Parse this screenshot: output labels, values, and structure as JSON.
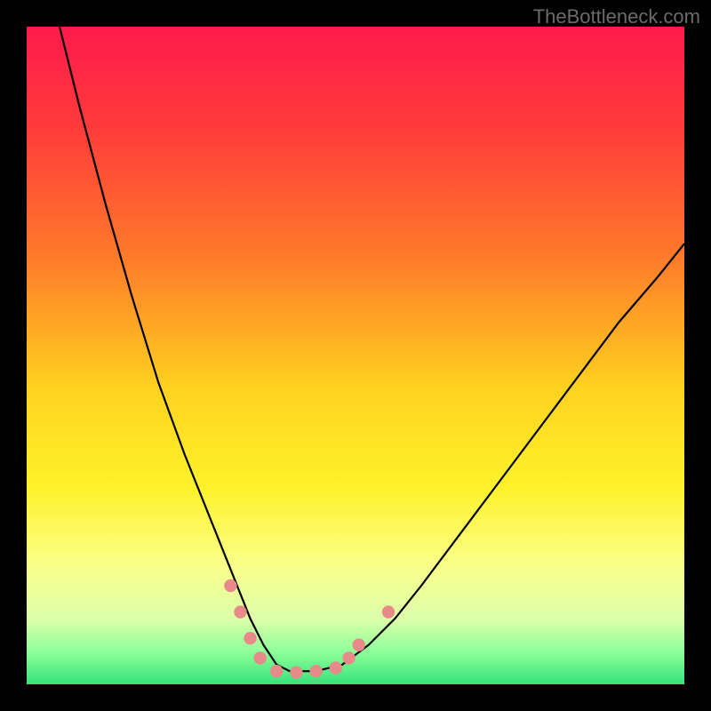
{
  "watermark": "TheBottleneck.com",
  "chart_data": {
    "type": "line",
    "title": "",
    "xlabel": "",
    "ylabel": "",
    "xlim": [
      0,
      100
    ],
    "ylim": [
      0,
      100
    ],
    "background_gradient_stops": [
      {
        "pos": 0.0,
        "color": "#ff1a4d"
      },
      {
        "pos": 0.15,
        "color": "#ff3a3a"
      },
      {
        "pos": 0.35,
        "color": "#ff7a2a"
      },
      {
        "pos": 0.55,
        "color": "#ffd21f"
      },
      {
        "pos": 0.7,
        "color": "#fff22a"
      },
      {
        "pos": 0.82,
        "color": "#faff8a"
      },
      {
        "pos": 0.9,
        "color": "#ddffaa"
      },
      {
        "pos": 0.95,
        "color": "#8fff99"
      },
      {
        "pos": 1.0,
        "color": "#36e27a"
      }
    ],
    "series": [
      {
        "name": "bottleneck-curve",
        "color": "#000000",
        "x": [
          5,
          8,
          12,
          16,
          20,
          24,
          28,
          30,
          32,
          34,
          36,
          38,
          40,
          44,
          48,
          52,
          56,
          60,
          66,
          72,
          78,
          84,
          90,
          96,
          100
        ],
        "y": [
          100,
          88,
          73,
          59,
          46,
          35,
          25,
          20,
          15,
          10,
          6,
          3,
          2,
          2,
          3,
          6,
          10,
          15,
          23,
          31,
          39,
          47,
          55,
          62,
          67
        ]
      }
    ],
    "markers": [
      {
        "name": "cluster-left-1",
        "x": 31,
        "y": 15,
        "r": 3,
        "color": "#e98a8a"
      },
      {
        "name": "cluster-left-2",
        "x": 32.5,
        "y": 11,
        "r": 3,
        "color": "#e98a8a"
      },
      {
        "name": "cluster-left-3",
        "x": 34,
        "y": 7,
        "r": 3,
        "color": "#e98a8a"
      },
      {
        "name": "cluster-left-4",
        "x": 35.5,
        "y": 4,
        "r": 3,
        "color": "#e98a8a"
      },
      {
        "name": "cluster-bottom-1",
        "x": 38,
        "y": 2,
        "r": 3,
        "color": "#e98a8a"
      },
      {
        "name": "cluster-bottom-2",
        "x": 41,
        "y": 1.8,
        "r": 3,
        "color": "#e98a8a"
      },
      {
        "name": "cluster-bottom-3",
        "x": 44,
        "y": 2,
        "r": 3,
        "color": "#e98a8a"
      },
      {
        "name": "cluster-bottom-4",
        "x": 47,
        "y": 2.5,
        "r": 3,
        "color": "#e98a8a"
      },
      {
        "name": "cluster-right-1",
        "x": 49,
        "y": 4,
        "r": 3,
        "color": "#e98a8a"
      },
      {
        "name": "cluster-right-2",
        "x": 50.5,
        "y": 6,
        "r": 3,
        "color": "#e98a8a"
      },
      {
        "name": "outlier-right",
        "x": 55,
        "y": 11,
        "r": 3,
        "color": "#e98a8a"
      }
    ]
  }
}
